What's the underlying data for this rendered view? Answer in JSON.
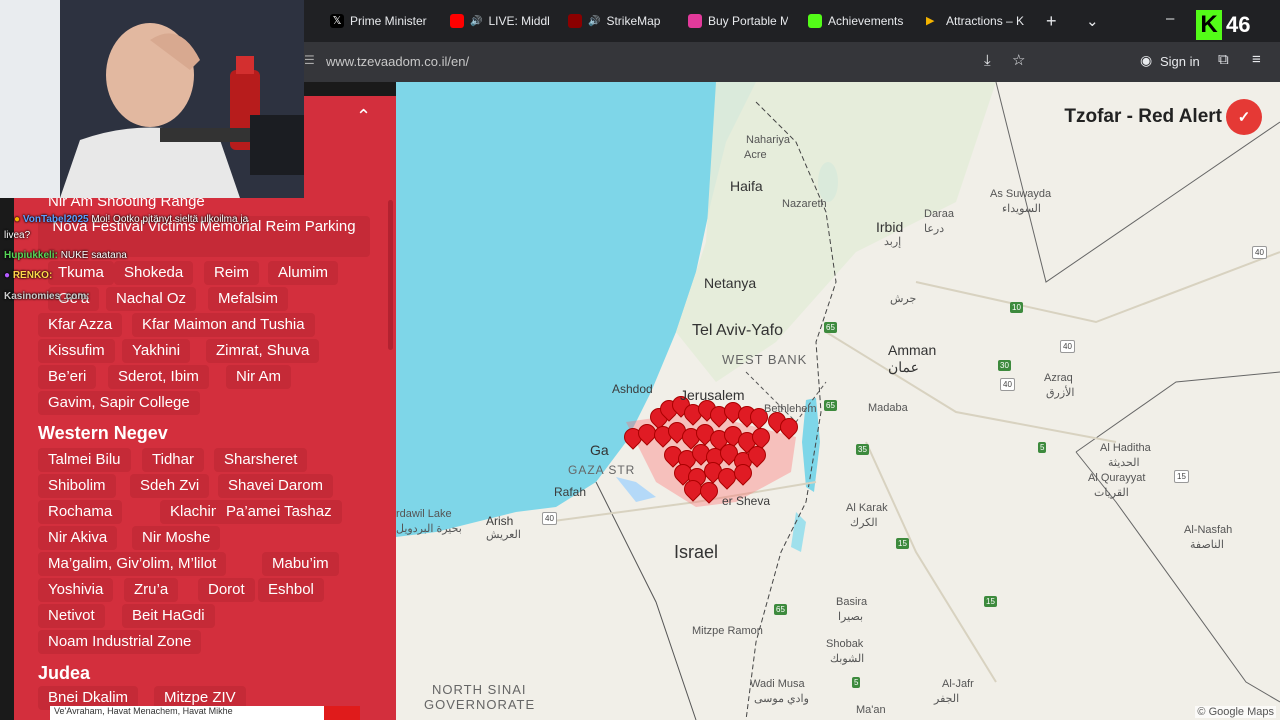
{
  "browser": {
    "tabs": [
      {
        "label": "Prime Minister",
        "icon": "x-logo-icon"
      },
      {
        "label": "LIVE: Middl",
        "icon": "youtube-icon"
      },
      {
        "label": "StrikeMap",
        "icon": "strikemap-icon"
      },
      {
        "label": "Buy Portable M",
        "icon": "shop-icon"
      },
      {
        "label": "Achievements",
        "icon": "kick-icon"
      },
      {
        "label": "Attractions – K",
        "icon": "flag-icon"
      }
    ],
    "url": "www.tzevaadom.co.il/en/",
    "sign_in": "Sign in"
  },
  "badge": {
    "letter": "K",
    "count": "46"
  },
  "map": {
    "title": "Tzofar - Red Alert",
    "credit": "© Google Maps",
    "labels": {
      "nahariya": "Nahariya",
      "acre": "Acre",
      "haifa": "Haifa",
      "nazareth": "Nazareth",
      "irbid": "Irbid",
      "irbid_ar": "إربد",
      "netanya": "Netanya",
      "tel_aviv": "Tel Aviv-Yafo",
      "west_bank": "WEST BANK",
      "amman": "Amman",
      "amman_ar": "عمان",
      "ashdod": "Ashdod",
      "jerusalem": "Jerusalem",
      "bethlehem": "Bethlehem",
      "gaza": "Ga",
      "gaza_strip": "GAZA STR",
      "rafah": "Rafah",
      "sheva": "er Sheva",
      "arish": "Arish",
      "arish_ar": "العريش",
      "israel": "Israel",
      "mitzpe": "Mitzpe Ramon",
      "north_sinai_1": "NORTH SINAI",
      "north_sinai_2": "GOVERNORATE",
      "suwayda": "As Suwayda",
      "suwayda_ar": "السويداء",
      "daraa": "Daraa",
      "daraa_ar": "درعا",
      "jerash": "جرش",
      "azraq": "Azraq",
      "azraq_ar": "الأزرق",
      "madaba": "Madaba",
      "karak": "Al Karak",
      "karak_ar": "الكرك",
      "haditha": "Al Haditha",
      "haditha_ar": "الحديثة",
      "qurayyat": "Al Qurayyat",
      "qurayyat_ar": "القريات",
      "nasfah": "Al-Nasfah",
      "nasfah_ar": "الناصفة",
      "basira": "Basira",
      "basira_ar": "بصيرا",
      "shobak": "Shobak",
      "shobak_ar": "الشوبك",
      "wadi_musa": "Wadi Musa",
      "wadi_musa_ar": "وادي موسى",
      "al_jafr": "Al-Jafr",
      "al_jafr_ar": "الجفر",
      "maan": "Ma'an",
      "bardawil": "rdawil Lake",
      "bardawil_ar": "بحيرة البردويل"
    },
    "roads": [
      "65",
      "40",
      "30",
      "40",
      "40",
      "35",
      "65",
      "15",
      "10",
      "5",
      "40",
      "15",
      "65",
      "5",
      "15"
    ]
  },
  "panel": {
    "partial_top": "Nir Am Shooting Range",
    "nova": "Nova Festival Victims Memorial Reim Parking",
    "gaza_envelope": [
      "Tkuma",
      "Shokeda",
      "Reim",
      "Alumim",
      "Ge'a",
      "Nachal Oz",
      "Mefalsim",
      "Kfar Azza",
      "Kfar Maimon and Tushia",
      "Kissufim",
      "Yakhini",
      "Zimrat, Shuva",
      "Be’eri",
      "Sderot, Ibim",
      "Nir Am",
      "Gavim, Sapir College"
    ],
    "western_negev_title": "Western Negev",
    "western_negev": [
      "Talmei Bilu",
      "Tidhar",
      "Sharsheret",
      "Shibolim",
      "Sdeh Zvi",
      "Shavei Darom",
      "Rochama",
      "Klachim",
      "Pa’amei Tashaz",
      "Nir Akiva",
      "Nir Moshe",
      "Ma’galim, Giv’olim, M’lilot",
      "Mabu’im",
      "Yoshivia",
      "Zru’a",
      "Dorot",
      "Eshbol",
      "Netivot",
      "Beit HaGdi",
      "Noam Industrial Zone"
    ],
    "judea_title": "Judea",
    "judea": [
      "Bnei Dkalim",
      "Mitzpe ZIV"
    ],
    "bottom_partial": "Ve'Avraham, Havat Menachem, Havat Mikhe"
  },
  "chat": [
    {
      "name": "VonTabel2025",
      "text": "Moi! Ootko pitänyt sieltä ulkoilma ja",
      "color": "#5aa0ff"
    },
    {
      "name": "",
      "text": "livea?",
      "color": "#ffffff"
    },
    {
      "name": "Hupiukkeli:",
      "text": "NUKE saatana",
      "color": "#57d657"
    },
    {
      "name": "RENKO:",
      "text": "",
      "color": "#ffd84a"
    },
    {
      "name": "Kasinomies_com:",
      "text": "",
      "color": "#cccccc"
    }
  ]
}
